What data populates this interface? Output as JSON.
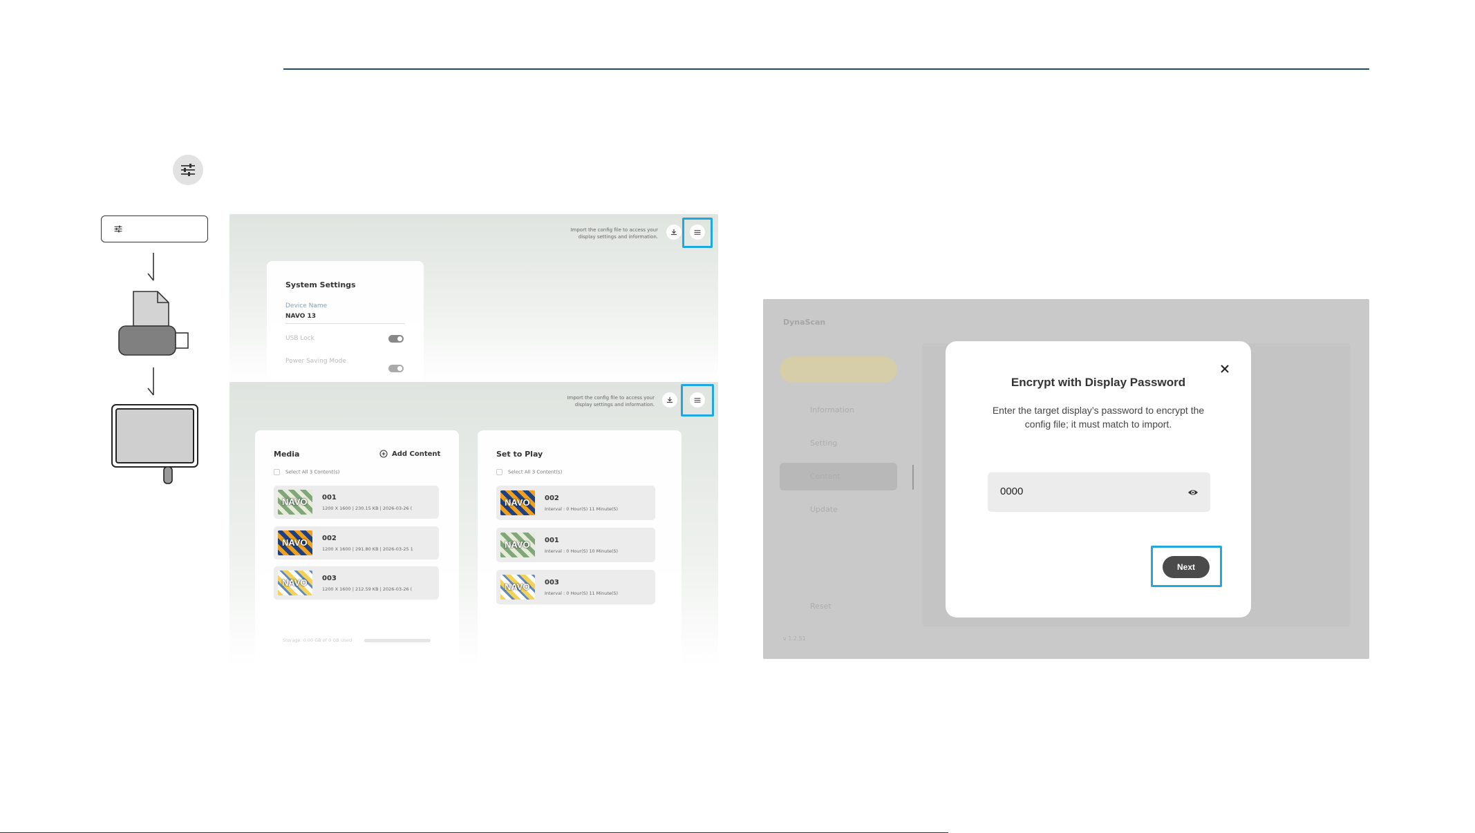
{
  "panel1": {
    "import_note": "Import the config file to access your display settings and information.",
    "system_settings": {
      "title": "System Settings",
      "device_name_label": "Device Name",
      "device_name_value": "NAVO 13",
      "usb_lock_label": "USB Lock",
      "power_saving_label": "Power Saving Mode"
    }
  },
  "panel2": {
    "import_note": "Import the config file to access your display settings and information.",
    "media": {
      "title": "Media",
      "add_content": "Add Content",
      "select_all": "Select All 3 Content(s)",
      "items": [
        {
          "name": "001",
          "meta": "1200 X 1600  |  230.15 KB  |  2026-03-26 ("
        },
        {
          "name": "002",
          "meta": "1200 X 1600  |  291.80 KB  |  2026-03-25 1"
        },
        {
          "name": "003",
          "meta": "1200 X 1600  |  212.59 KB  |  2026-03-26 ("
        }
      ],
      "storage": "Storage: 0.00 GB of 0 GB Used"
    },
    "set_to_play": {
      "title": "Set to Play",
      "select_all": "Select All 3 Content(s)",
      "items": [
        {
          "name": "002",
          "meta": "Interval : 0 Hour(S) 11 Minute(S)"
        },
        {
          "name": "001",
          "meta": "Interval : 0 Hour(S) 10 Minute(S)"
        },
        {
          "name": "003",
          "meta": "Interval : 0 Hour(S) 11 Minute(S)"
        }
      ]
    }
  },
  "panel3": {
    "brand": "DynaScan",
    "sidebar": [
      "Information",
      "Setting",
      "Content",
      "Update"
    ],
    "reset": "Reset",
    "version": "v 1.2.51"
  },
  "dialog": {
    "title": "Encrypt with Display Password",
    "message": "Enter the target display’s password to encrypt the config file; it must match to import.",
    "password_value": "0000",
    "next_label": "Next"
  },
  "colors": {
    "highlight": "#1fa8e0",
    "rule": "#1f4a63",
    "next_button": "#4a4a4a"
  }
}
